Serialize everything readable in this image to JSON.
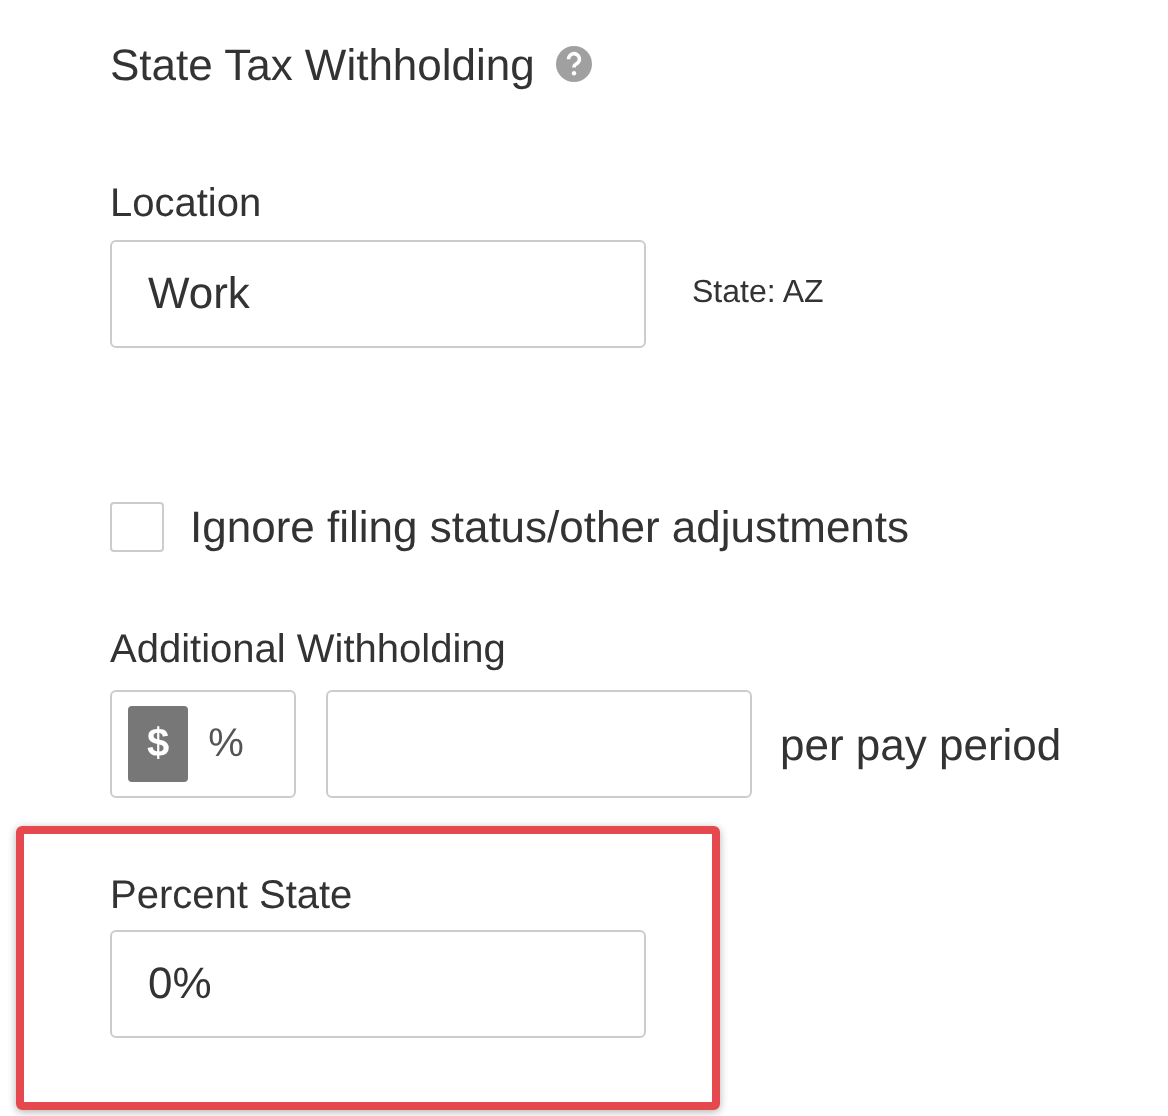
{
  "title": "State Tax Withholding",
  "location": {
    "label": "Location",
    "value": "Work",
    "state_text": "State: AZ"
  },
  "ignore": {
    "label": "Ignore filing status/other adjustments",
    "checked": false
  },
  "additional": {
    "label": "Additional Withholding",
    "units": [
      {
        "label": "$",
        "selected": true
      },
      {
        "label": "%",
        "selected": false
      }
    ],
    "suffix": "per pay period"
  },
  "percent_state": {
    "label": "Percent State",
    "value": "0%",
    "highlighted": true
  }
}
